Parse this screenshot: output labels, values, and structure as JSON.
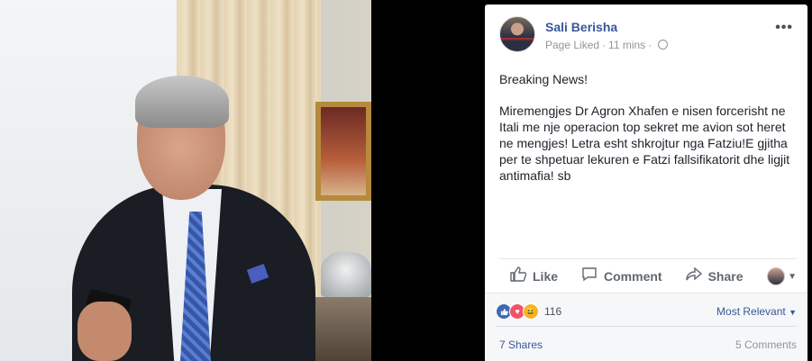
{
  "post": {
    "author": "Sali Berisha",
    "page_status": "Page Liked",
    "time": "11 mins",
    "more_label": "•••",
    "paragraphs": [
      "Breaking News!",
      "Miremengjes Dr Agron Xhafen e nisen forcerisht ne Itali me nje operacion top sekret me avion sot heret ne mengjes! Letra esht shkrojtur nga Fatziu!E gjitha per te shpetuar lekuren e Fatzi fallsifikatorit dhe ligjit antimafia! sb"
    ]
  },
  "actions": {
    "like": "Like",
    "comment": "Comment",
    "share": "Share"
  },
  "icons": {
    "like": "thumbs-up-icon",
    "comment": "speech-bubble-icon",
    "share": "share-arrow-icon",
    "privacy": "globe-icon",
    "more": "ellipsis-icon"
  },
  "reactions": {
    "count": "116",
    "types": [
      "like",
      "love",
      "haha"
    ],
    "sort_label": "Most Relevant"
  },
  "stats": {
    "shares": "7 Shares",
    "comments": "5 Comments"
  },
  "colors": {
    "link": "#365899",
    "text": "#1d2129",
    "muted": "#90949c",
    "background": "#000000"
  }
}
